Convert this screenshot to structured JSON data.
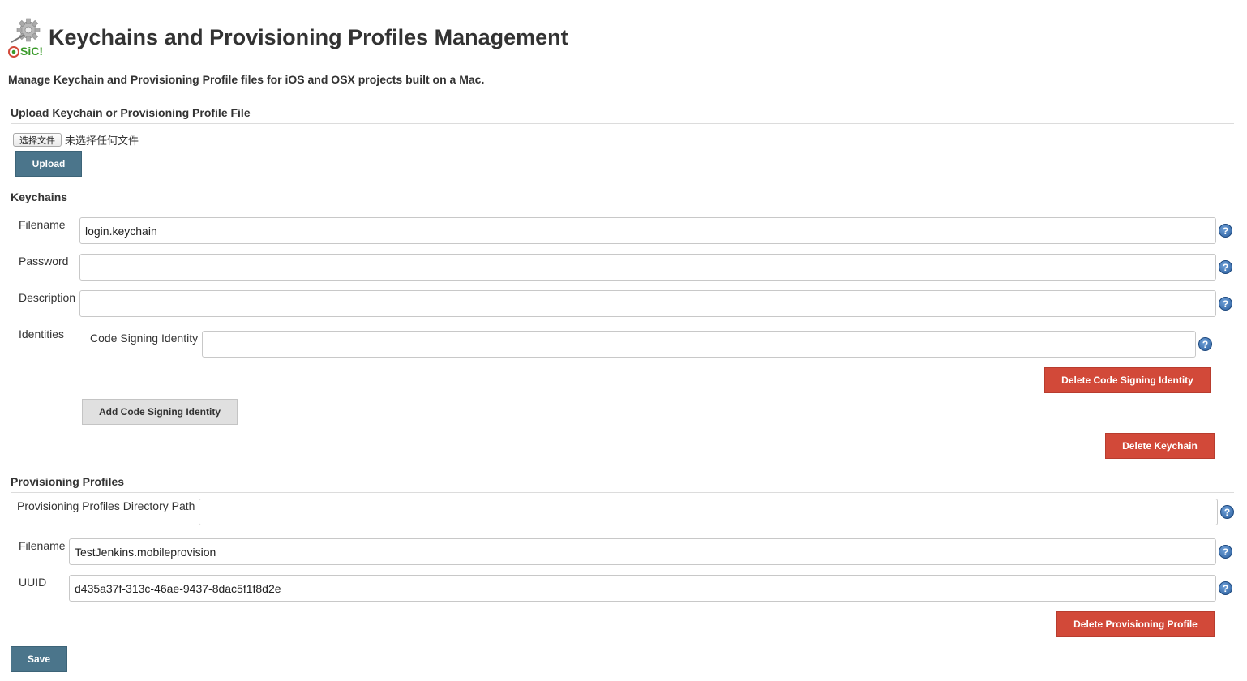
{
  "header": {
    "logo_text": "SiC!",
    "title": "Keychains and Provisioning Profiles Management",
    "subtitle": "Manage Keychain and Provisioning Profile files for iOS and OSX projects built on a Mac."
  },
  "upload": {
    "heading": "Upload Keychain or Provisioning Profile File",
    "choose_file_label": "选择文件",
    "no_file_text": "未选择任何文件",
    "upload_label": "Upload"
  },
  "keychains": {
    "heading": "Keychains",
    "filename_label": "Filename",
    "filename_value": "login.keychain",
    "password_label": "Password",
    "password_value": "",
    "description_label": "Description",
    "description_value": "",
    "identities_label": "Identities",
    "code_signing_label": "Code Signing Identity",
    "code_signing_value": "",
    "delete_identity_label": "Delete Code Signing Identity",
    "add_identity_label": "Add Code Signing Identity",
    "delete_keychain_label": "Delete Keychain"
  },
  "profiles": {
    "heading": "Provisioning Profiles",
    "dir_path_label": "Provisioning Profiles Directory Path",
    "dir_path_value": "",
    "filename_label": "Filename",
    "filename_value": "TestJenkins.mobileprovision",
    "uuid_label": "UUID",
    "uuid_value": "d435a37f-313c-46ae-9437-8dac5f1f8d2e",
    "delete_profile_label": "Delete Provisioning Profile"
  },
  "footer": {
    "save_label": "Save"
  },
  "help_icon_glyph": "?",
  "colors": {
    "primary_button": "#4b758b",
    "danger_button": "#d24939",
    "secondary_button": "#e0e0e0",
    "help_icon": "#2b5f9e"
  }
}
